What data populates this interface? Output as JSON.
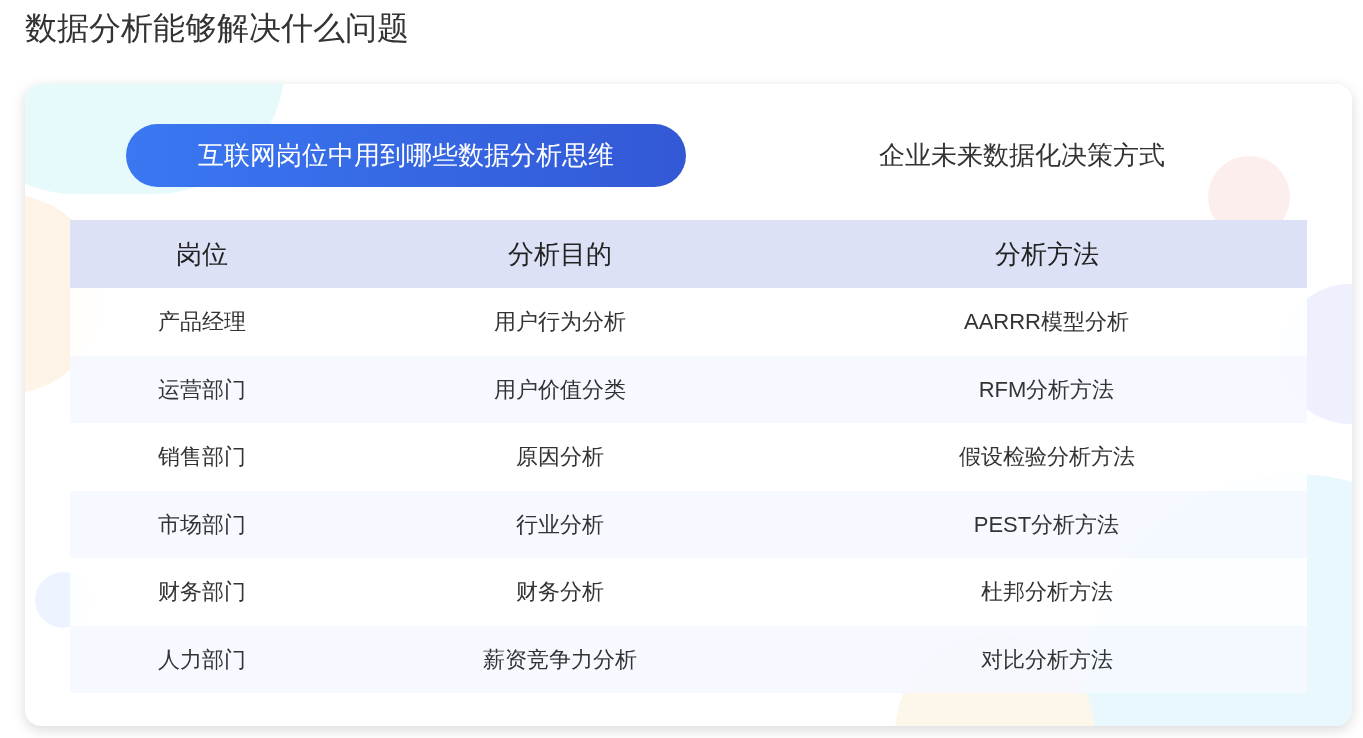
{
  "title": "数据分析能够解决什么问题",
  "tabs": [
    {
      "label": "互联网岗位中用到哪些数据分析思维",
      "selected": true
    },
    {
      "label": "企业未来数据化决策方式",
      "selected": false
    }
  ],
  "table": {
    "columns": [
      "岗位",
      "分析目的",
      "分析方法"
    ],
    "rows": [
      [
        "产品经理",
        "用户行为分析",
        "AARRR模型分析"
      ],
      [
        "运营部门",
        "用户价值分类",
        "RFM分析方法"
      ],
      [
        "销售部门",
        "原因分析",
        "假设检验分析方法"
      ],
      [
        "市场部门",
        "行业分析",
        "PEST分析方法"
      ],
      [
        "财务部门",
        "财务分析",
        "杜邦分析方法"
      ],
      [
        "人力部门",
        "薪资竞争力分析",
        "对比分析方法"
      ]
    ]
  }
}
